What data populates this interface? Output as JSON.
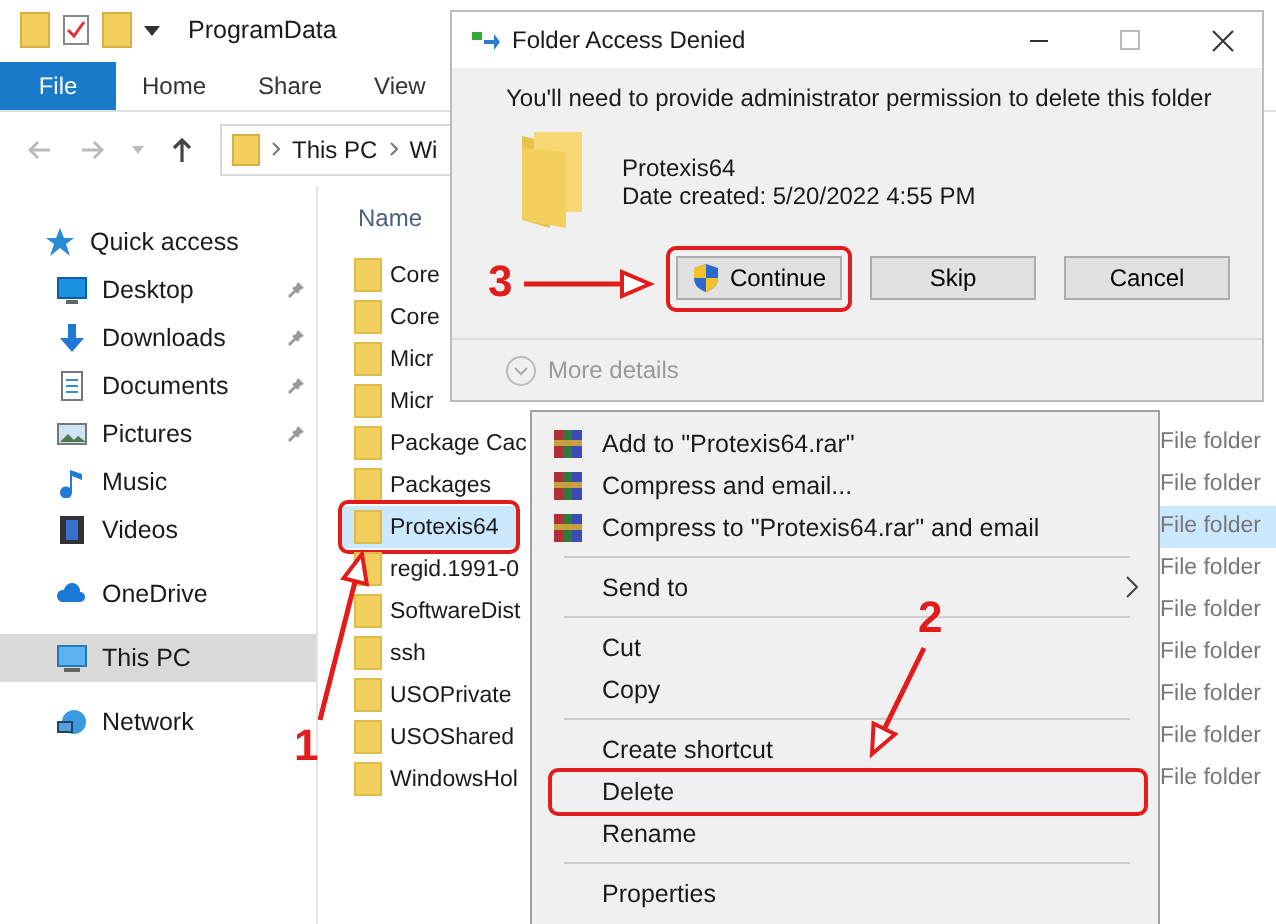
{
  "window": {
    "title": "ProgramData"
  },
  "ribbon_tabs": [
    {
      "label": "File",
      "selected": true
    },
    {
      "label": "Home",
      "selected": false
    },
    {
      "label": "Share",
      "selected": false
    },
    {
      "label": "View",
      "selected": false
    }
  ],
  "address": {
    "breadcrumbs": [
      "This PC",
      "Wi"
    ]
  },
  "sidebar": {
    "items": [
      {
        "label": "Quick access",
        "kind": "star",
        "pinned": false,
        "selected": false
      },
      {
        "label": "Desktop",
        "kind": "desktop",
        "pinned": true,
        "selected": false
      },
      {
        "label": "Downloads",
        "kind": "download",
        "pinned": true,
        "selected": false
      },
      {
        "label": "Documents",
        "kind": "document",
        "pinned": true,
        "selected": false
      },
      {
        "label": "Pictures",
        "kind": "picture",
        "pinned": true,
        "selected": false
      },
      {
        "label": "Music",
        "kind": "music",
        "pinned": false,
        "selected": false
      },
      {
        "label": "Videos",
        "kind": "video",
        "pinned": false,
        "selected": false
      },
      {
        "label": "OneDrive",
        "kind": "cloud",
        "pinned": false,
        "selected": false
      },
      {
        "label": "This PC",
        "kind": "pc",
        "pinned": false,
        "selected": true
      },
      {
        "label": "Network",
        "kind": "network",
        "pinned": false,
        "selected": false
      }
    ]
  },
  "file_list": {
    "name_header": "Name",
    "rows": [
      {
        "name": "Core",
        "selected": false,
        "marked": false
      },
      {
        "name": "Core",
        "selected": false,
        "marked": false
      },
      {
        "name": "Micr",
        "selected": false,
        "marked": false
      },
      {
        "name": "Micr",
        "selected": false,
        "marked": false
      },
      {
        "name": "Package Cac",
        "type": "File folder",
        "selected": false,
        "marked": false
      },
      {
        "name": "Packages",
        "type": "File folder",
        "selected": false,
        "marked": false
      },
      {
        "name": "Protexis64",
        "type": "File folder",
        "selected": true,
        "marked": true
      },
      {
        "name": "regid.1991-0",
        "type": "File folder",
        "selected": false,
        "marked": false
      },
      {
        "name": "SoftwareDist",
        "type": "File folder",
        "selected": false,
        "marked": false
      },
      {
        "name": "ssh",
        "type": "File folder",
        "selected": false,
        "marked": false
      },
      {
        "name": "USOPrivate",
        "type": "File folder",
        "selected": false,
        "marked": false
      },
      {
        "name": "USOShared",
        "type": "File folder",
        "selected": false,
        "marked": false
      },
      {
        "name": "WindowsHol",
        "type": "File folder",
        "selected": false,
        "marked": false
      }
    ]
  },
  "context_menu": {
    "items": [
      {
        "kind": "rar",
        "label": "Add to \"Protexis64.rar\"",
        "marked": false
      },
      {
        "kind": "rar",
        "label": "Compress and email...",
        "marked": false
      },
      {
        "kind": "rar",
        "label": "Compress to \"Protexis64.rar\" and email",
        "marked": false
      },
      {
        "kind": "separator"
      },
      {
        "kind": "submenu",
        "label": "Send to",
        "marked": false
      },
      {
        "kind": "separator"
      },
      {
        "kind": "plain",
        "label": "Cut",
        "marked": false
      },
      {
        "kind": "plain",
        "label": "Copy",
        "marked": false
      },
      {
        "kind": "separator"
      },
      {
        "kind": "plain",
        "label": "Create shortcut",
        "marked": false
      },
      {
        "kind": "plain",
        "label": "Delete",
        "marked": true
      },
      {
        "kind": "plain",
        "label": "Rename",
        "marked": false
      },
      {
        "kind": "separator"
      },
      {
        "kind": "plain",
        "label": "Properties",
        "marked": false
      }
    ]
  },
  "dialog": {
    "title": "Folder Access Denied",
    "message": "You'll need to provide administrator permission to delete this folder",
    "item_name": "Protexis64",
    "item_date": "Date created: 5/20/2022 4:55 PM",
    "buttons": [
      {
        "label": "Continue",
        "kind": "shield",
        "marked": true
      },
      {
        "label": "Skip",
        "kind": "plain",
        "marked": false
      },
      {
        "label": "Cancel",
        "kind": "plain",
        "marked": false
      }
    ],
    "details_label": "More details"
  },
  "annotations": [
    {
      "number": "1"
    },
    {
      "number": "2"
    },
    {
      "number": "3"
    }
  ]
}
